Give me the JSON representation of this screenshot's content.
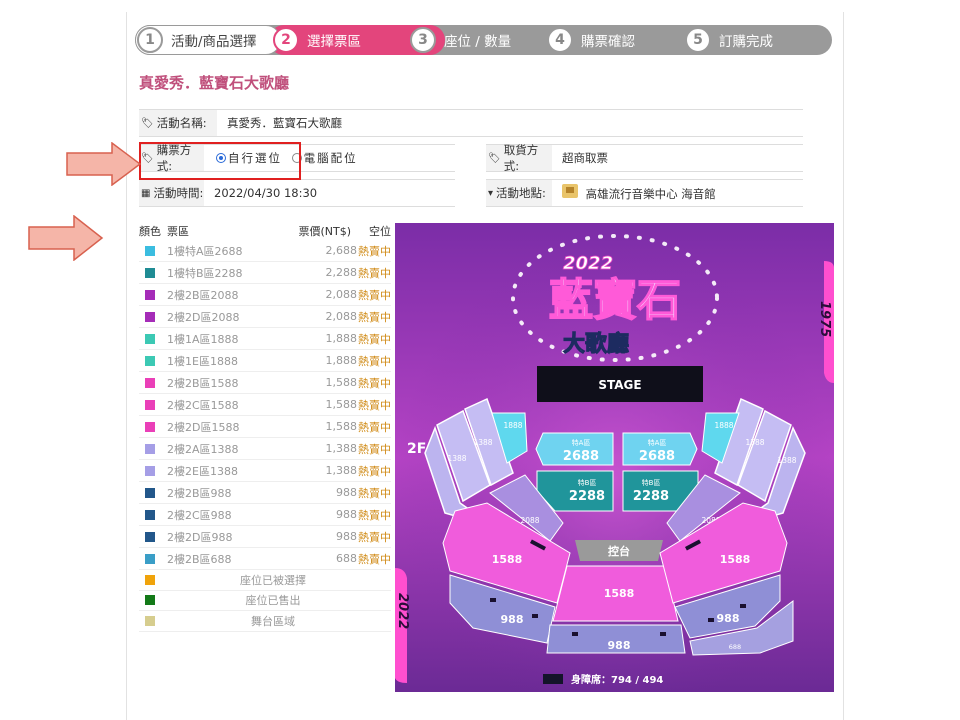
{
  "steps": [
    {
      "num": "1",
      "label": "活動/商品選擇"
    },
    {
      "num": "2",
      "label": "選擇票區"
    },
    {
      "num": "3",
      "label": "座位 / 數量"
    },
    {
      "num": "4",
      "label": "購票確認"
    },
    {
      "num": "5",
      "label": "訂購完成"
    }
  ],
  "event_title": "真愛秀．藍寶石大歌廳",
  "info": {
    "name_label": "活動名稱:",
    "name_value": "真愛秀．藍寶石大歌廳",
    "method_label": "購票方式:",
    "method_option1": "自行選位",
    "method_option2": "電腦配位",
    "pickup_label": "取貨方式:",
    "pickup_value": "超商取票",
    "time_label": "活動時間:",
    "time_value": "2022/04/30 18:30",
    "place_label": "活動地點:",
    "place_value": "高雄流行音樂中心 海音館"
  },
  "table_headers": {
    "color": "顏色",
    "zone": "票區",
    "price": "票價(NT$)",
    "status": "空位"
  },
  "zones": [
    {
      "name": "1樓特A區2688",
      "price": "2,688",
      "status": "熱賣中",
      "color": "#3bbde0"
    },
    {
      "name": "1樓特B區2288",
      "price": "2,288",
      "status": "熱賣中",
      "color": "#1f8c94"
    },
    {
      "name": "2樓2B區2088",
      "price": "2,088",
      "status": "熱賣中",
      "color": "#a52cb8"
    },
    {
      "name": "2樓2D區2088",
      "price": "2,088",
      "status": "熱賣中",
      "color": "#a52cb8"
    },
    {
      "name": "1樓1A區1888",
      "price": "1,888",
      "status": "熱賣中",
      "color": "#3cc9b4"
    },
    {
      "name": "1樓1E區1888",
      "price": "1,888",
      "status": "熱賣中",
      "color": "#3cc9b4"
    },
    {
      "name": "2樓2B區1588",
      "price": "1,588",
      "status": "熱賣中",
      "color": "#ea3fb8"
    },
    {
      "name": "2樓2C區1588",
      "price": "1,588",
      "status": "熱賣中",
      "color": "#ea3fb8"
    },
    {
      "name": "2樓2D區1588",
      "price": "1,588",
      "status": "熱賣中",
      "color": "#ea3fb8"
    },
    {
      "name": "2樓2A區1388",
      "price": "1,388",
      "status": "熱賣中",
      "color": "#a59ee6"
    },
    {
      "name": "2樓2E區1388",
      "price": "1,388",
      "status": "熱賣中",
      "color": "#a59ee6"
    },
    {
      "name": "2樓2B區988",
      "price": "988",
      "status": "熱賣中",
      "color": "#22578a"
    },
    {
      "name": "2樓2C區988",
      "price": "988",
      "status": "熱賣中",
      "color": "#22578a"
    },
    {
      "name": "2樓2D區988",
      "price": "988",
      "status": "熱賣中",
      "color": "#22578a"
    },
    {
      "name": "2樓2B區688",
      "price": "688",
      "status": "熱賣中",
      "color": "#3a9ec7"
    }
  ],
  "legend": [
    {
      "label": "座位已被選擇",
      "color": "#f0a30a"
    },
    {
      "label": "座位已售出",
      "color": "#137a18"
    },
    {
      "label": "舞台區域",
      "color": "#d6cd8e"
    }
  ],
  "seatmap": {
    "logo_year": "2022",
    "logo_title": "藍寶石",
    "logo_sub": "大歌廳",
    "side_year_top": "1975",
    "side_year_bottom": "2022",
    "stage": "STAGE",
    "floor_label": "2F",
    "front_a_left_title": "特A區",
    "front_a_left_price": "2688",
    "front_a_right_title": "特A區",
    "front_a_right_price": "2688",
    "front_b_left_title": "特B區",
    "front_b_left_price": "2288",
    "front_b_right_title": "特B區",
    "front_b_right_price": "2288",
    "p1888_left": "1888",
    "p1888_right": "1888",
    "p1388_l1": "1388",
    "p1388_l2": "1388",
    "p1388_r1": "1388",
    "p1388_r2": "1388",
    "p2088_left": "2088",
    "p2088_right": "2088",
    "console": "控台",
    "p1588_left": "1588",
    "p1588_center": "1588",
    "p1588_right": "1588",
    "p988_left": "988",
    "p988_center": "988",
    "p988_right": "988",
    "p688": "688",
    "accessible": "身障席：794 / 494"
  }
}
